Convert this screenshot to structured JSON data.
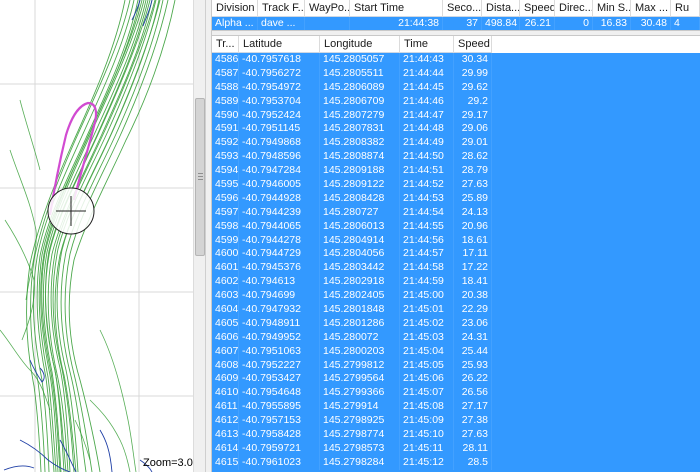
{
  "map": {
    "zoom_label": "Zoom=3.0"
  },
  "tracks_table": {
    "columns": [
      "Division",
      "Track F...",
      "WayPo...",
      "Start Time",
      "Seco...",
      "Dista...",
      "Speed",
      "Direc...",
      "Min S...",
      "Max ...",
      "Ru"
    ],
    "rows": [
      [
        "Alpha ...",
        "dave ...",
        "",
        "21:44:38",
        "37",
        "498.84",
        "26.21",
        "0",
        "16.83",
        "30.48",
        "4"
      ]
    ]
  },
  "points_table": {
    "columns": [
      "Tr...",
      "Latitude",
      "Longitude",
      "Time",
      "Speed"
    ],
    "rows": [
      [
        "4586",
        "-40.7957618",
        "145.2805057",
        "21:44:43",
        "30.34"
      ],
      [
        "4587",
        "-40.7956272",
        "145.2805511",
        "21:44:44",
        "29.99"
      ],
      [
        "4588",
        "-40.7954972",
        "145.2806089",
        "21:44:45",
        "29.62"
      ],
      [
        "4589",
        "-40.7953704",
        "145.2806709",
        "21:44:46",
        "29.2"
      ],
      [
        "4590",
        "-40.7952424",
        "145.2807279",
        "21:44:47",
        "29.17"
      ],
      [
        "4591",
        "-40.7951145",
        "145.2807831",
        "21:44:48",
        "29.06"
      ],
      [
        "4592",
        "-40.7949868",
        "145.2808382",
        "21:44:49",
        "29.01"
      ],
      [
        "4593",
        "-40.7948596",
        "145.2808874",
        "21:44:50",
        "28.62"
      ],
      [
        "4594",
        "-40.7947284",
        "145.2809188",
        "21:44:51",
        "28.79"
      ],
      [
        "4595",
        "-40.7946005",
        "145.2809122",
        "21:44:52",
        "27.63"
      ],
      [
        "4596",
        "-40.7944928",
        "145.2808428",
        "21:44:53",
        "25.89"
      ],
      [
        "4597",
        "-40.7944239",
        "145.280727",
        "21:44:54",
        "24.13"
      ],
      [
        "4598",
        "-40.7944065",
        "145.2806013",
        "21:44:55",
        "20.96"
      ],
      [
        "4599",
        "-40.7944278",
        "145.2804914",
        "21:44:56",
        "18.61"
      ],
      [
        "4600",
        "-40.7944729",
        "145.2804056",
        "21:44:57",
        "17.11"
      ],
      [
        "4601",
        "-40.7945376",
        "145.2803442",
        "21:44:58",
        "17.22"
      ],
      [
        "4602",
        "-40.794613",
        "145.2802918",
        "21:44:59",
        "18.41"
      ],
      [
        "4603",
        "-40.794699",
        "145.2802405",
        "21:45:00",
        "20.38"
      ],
      [
        "4604",
        "-40.7947932",
        "145.2801848",
        "21:45:01",
        "22.29"
      ],
      [
        "4605",
        "-40.7948911",
        "145.2801286",
        "21:45:02",
        "23.06"
      ],
      [
        "4606",
        "-40.7949952",
        "145.280072",
        "21:45:03",
        "24.31"
      ],
      [
        "4607",
        "-40.7951063",
        "145.2800203",
        "21:45:04",
        "25.44"
      ],
      [
        "4608",
        "-40.7952227",
        "145.2799812",
        "21:45:05",
        "25.93"
      ],
      [
        "4609",
        "-40.7953427",
        "145.2799564",
        "21:45:06",
        "26.22"
      ],
      [
        "4610",
        "-40.7954648",
        "145.2799366",
        "21:45:07",
        "26.56"
      ],
      [
        "4611",
        "-40.7955895",
        "145.279914",
        "21:45:08",
        "27.17"
      ],
      [
        "4612",
        "-40.7957153",
        "145.2798925",
        "21:45:09",
        "27.38"
      ],
      [
        "4613",
        "-40.7958428",
        "145.2798774",
        "21:45:10",
        "27.63"
      ],
      [
        "4614",
        "-40.7959721",
        "145.2798573",
        "21:45:11",
        "28.11"
      ],
      [
        "4615",
        "-40.7961023",
        "145.2798284",
        "21:45:12",
        "28.5"
      ]
    ]
  },
  "colors": {
    "selection": "#3399ff",
    "track_green": "#2e9a2e",
    "track_blue": "#1f3fa6",
    "highlight_magenta": "#d14bd1"
  }
}
